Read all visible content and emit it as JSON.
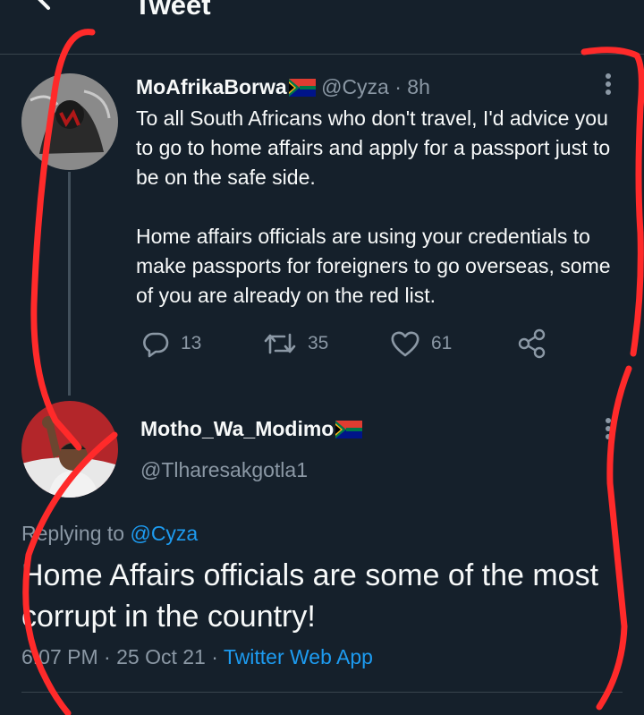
{
  "header": {
    "title": "Tweet"
  },
  "parent_tweet": {
    "author_name": "MoAfrikaBorwa",
    "handle": "@Cyza",
    "separator": "·",
    "time": "8h",
    "body": "To all South Africans who don't travel, I'd advice you to go to home affairs and apply for a passport just to be on the safe side.\n\nHome affairs officials are using your credentials to make passports for foreigners to go overseas, some of you are already on the red list.",
    "replies": "13",
    "retweets": "35",
    "likes": "61"
  },
  "main_tweet": {
    "author_name": "Motho_Wa_Modimo",
    "handle": "@Tlharesakgotla1",
    "replying_prefix": "Replying to",
    "replying_to": "@Cyza",
    "body": "Home Affairs officials are some of the most corrupt in the country!",
    "time": "6:07 PM",
    "sep1": "·",
    "date": "25 Oct 21",
    "sep2": "·",
    "source": "Twitter Web App"
  },
  "colors": {
    "background": "#15202b",
    "accent": "#1d9bf0",
    "muted": "#8b98a5",
    "annotation": "#ff2a2a"
  },
  "icons": [
    "back-arrow-icon",
    "reply-icon",
    "retweet-icon",
    "like-icon",
    "share-icon",
    "more-options-icon",
    "south-africa-flag-icon"
  ]
}
